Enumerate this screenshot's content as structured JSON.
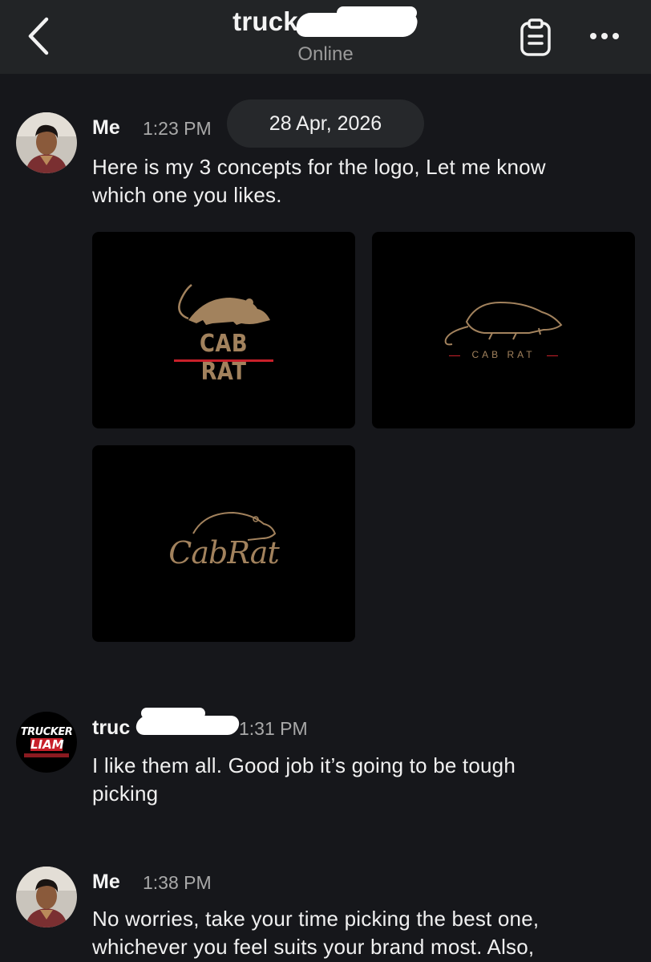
{
  "header": {
    "title": "truck",
    "status": "Online",
    "back_icon": "chevron-left-icon",
    "notes_icon": "clipboard-icon",
    "more_icon": "more-horizontal-icon"
  },
  "date_separator": "28 Apr, 2026",
  "messages": [
    {
      "sender": "Me",
      "time": "1:23 PM",
      "text_line1": "Here is my 3 concepts for the logo, Let me know",
      "text_line2": "which one you likes.",
      "attachments": [
        {
          "logo_text": "CAB RAT"
        },
        {
          "logo_text": "CAB RAT"
        },
        {
          "logo_text": "CabRat"
        }
      ]
    },
    {
      "sender": "truc",
      "time": "1:31 PM",
      "avatar_text_top": "TRUCKER",
      "avatar_text_bottom": "LIAM",
      "text_line1": "I like them all. Good job it’s going to be tough",
      "text_line2": "picking"
    },
    {
      "sender": "Me",
      "time": "1:38 PM",
      "text_line1": "No worries, take your time picking the best one,",
      "text_line2": "whichever you feel suits your brand most. Also,"
    }
  ],
  "colors": {
    "background": "#16171b",
    "header": "#222426",
    "logo_gold": "#a2825d",
    "accent_red": "#c8202a"
  }
}
